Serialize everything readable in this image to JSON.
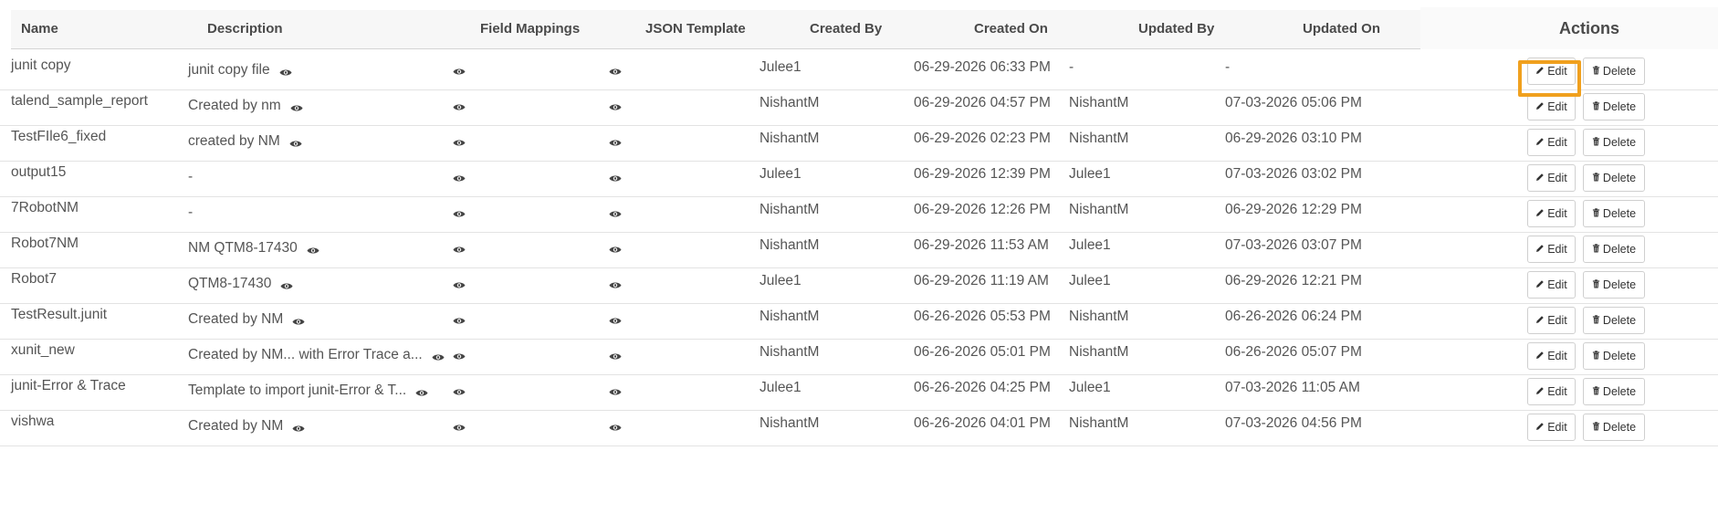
{
  "table": {
    "columns": [
      "Name",
      "Description",
      "Field Mappings",
      "JSON Template",
      "Created By",
      "Created On",
      "Updated By",
      "Updated On",
      "Actions"
    ],
    "edit_label": "Edit",
    "delete_label": "Delete",
    "highlight_color": "#f0a01e",
    "rows": [
      {
        "name": "junit copy",
        "description": "junit copy file",
        "desc_has_icon": true,
        "created_by": "Julee1",
        "created_on": "06-29-2026 06:33 PM",
        "updated_by": "-",
        "updated_on": "-"
      },
      {
        "name": "talend_sample_report",
        "description": "Created by nm",
        "desc_has_icon": true,
        "created_by": "NishantM",
        "created_on": "06-29-2026 04:57 PM",
        "updated_by": "NishantM",
        "updated_on": "07-03-2026 05:06 PM"
      },
      {
        "name": "TestFIle6_fixed",
        "description": "created by NM",
        "desc_has_icon": true,
        "created_by": "NishantM",
        "created_on": "06-29-2026 02:23 PM",
        "updated_by": "NishantM",
        "updated_on": "06-29-2026 03:10 PM"
      },
      {
        "name": "output15",
        "description": "-",
        "desc_has_icon": false,
        "created_by": "Julee1",
        "created_on": "06-29-2026 12:39 PM",
        "updated_by": "Julee1",
        "updated_on": "07-03-2026 03:02 PM"
      },
      {
        "name": "7RobotNM",
        "description": "-",
        "desc_has_icon": false,
        "created_by": "NishantM",
        "created_on": "06-29-2026 12:26 PM",
        "updated_by": "NishantM",
        "updated_on": "06-29-2026 12:29 PM"
      },
      {
        "name": "Robot7NM",
        "description": "NM QTM8-17430",
        "desc_has_icon": true,
        "created_by": "NishantM",
        "created_on": "06-29-2026 11:53 AM",
        "updated_by": "Julee1",
        "updated_on": "07-03-2026 03:07 PM"
      },
      {
        "name": "Robot7",
        "description": "QTM8-17430",
        "desc_has_icon": true,
        "created_by": "Julee1",
        "created_on": "06-29-2026 11:19 AM",
        "updated_by": "Julee1",
        "updated_on": "06-29-2026 12:21 PM"
      },
      {
        "name": "TestResult.junit",
        "description": "Created by NM",
        "desc_has_icon": true,
        "created_by": "NishantM",
        "created_on": "06-26-2026 05:53 PM",
        "updated_by": "NishantM",
        "updated_on": "06-26-2026 06:24 PM"
      },
      {
        "name": "xunit_new",
        "description": "Created by NM... with Error Trace a...",
        "desc_has_icon": true,
        "created_by": "NishantM",
        "created_on": "06-26-2026 05:01 PM",
        "updated_by": "NishantM",
        "updated_on": "06-26-2026 05:07 PM"
      },
      {
        "name": "junit-Error & Trace",
        "description": "Template to import junit-Error & T...",
        "desc_has_icon": true,
        "created_by": "Julee1",
        "created_on": "06-26-2026 04:25 PM",
        "updated_by": "Julee1",
        "updated_on": "07-03-2026 11:05 AM"
      },
      {
        "name": "vishwa",
        "description": "Created by NM",
        "desc_has_icon": true,
        "created_by": "NishantM",
        "created_on": "06-26-2026 04:01 PM",
        "updated_by": "NishantM",
        "updated_on": "07-03-2026 04:56 PM"
      }
    ]
  }
}
